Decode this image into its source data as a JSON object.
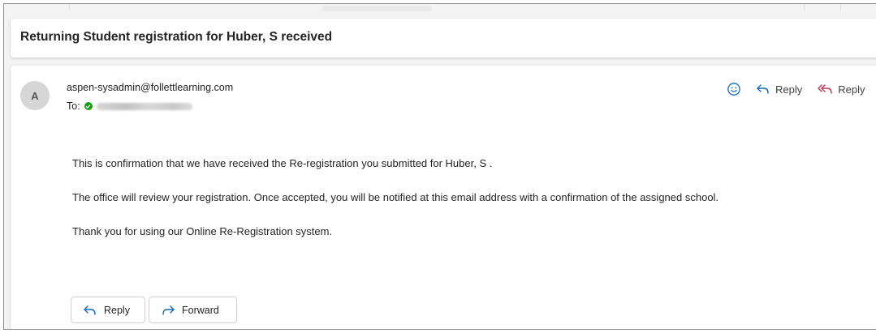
{
  "subject": "Returning Student registration for Huber, S received",
  "message": {
    "avatar_initial": "A",
    "sender": "aspen-sysadmin@follettlearning.com",
    "to_label": "To:",
    "body": [
      "This is confirmation that we have received the Re-registration you submitted for Huber, S .",
      "The office will review your registration. Once accepted, you will be notified at this email address with a confirmation of the assigned school.",
      "Thank you for using our Online Re-Registration system."
    ]
  },
  "header_actions": {
    "reply_label": "Reply",
    "reply_all_label": "Reply"
  },
  "footer_actions": {
    "reply_label": "Reply",
    "forward_label": "Forward"
  },
  "colors": {
    "accent": "#0f6cbd",
    "presence": "#13a10e",
    "reply_all_icon": "#c0385a"
  },
  "icons": {
    "emoji": "smiley-icon",
    "reply": "reply-arrow-icon",
    "reply_all": "reply-all-icon",
    "forward": "forward-arrow-icon",
    "presence": "available-check-icon"
  }
}
